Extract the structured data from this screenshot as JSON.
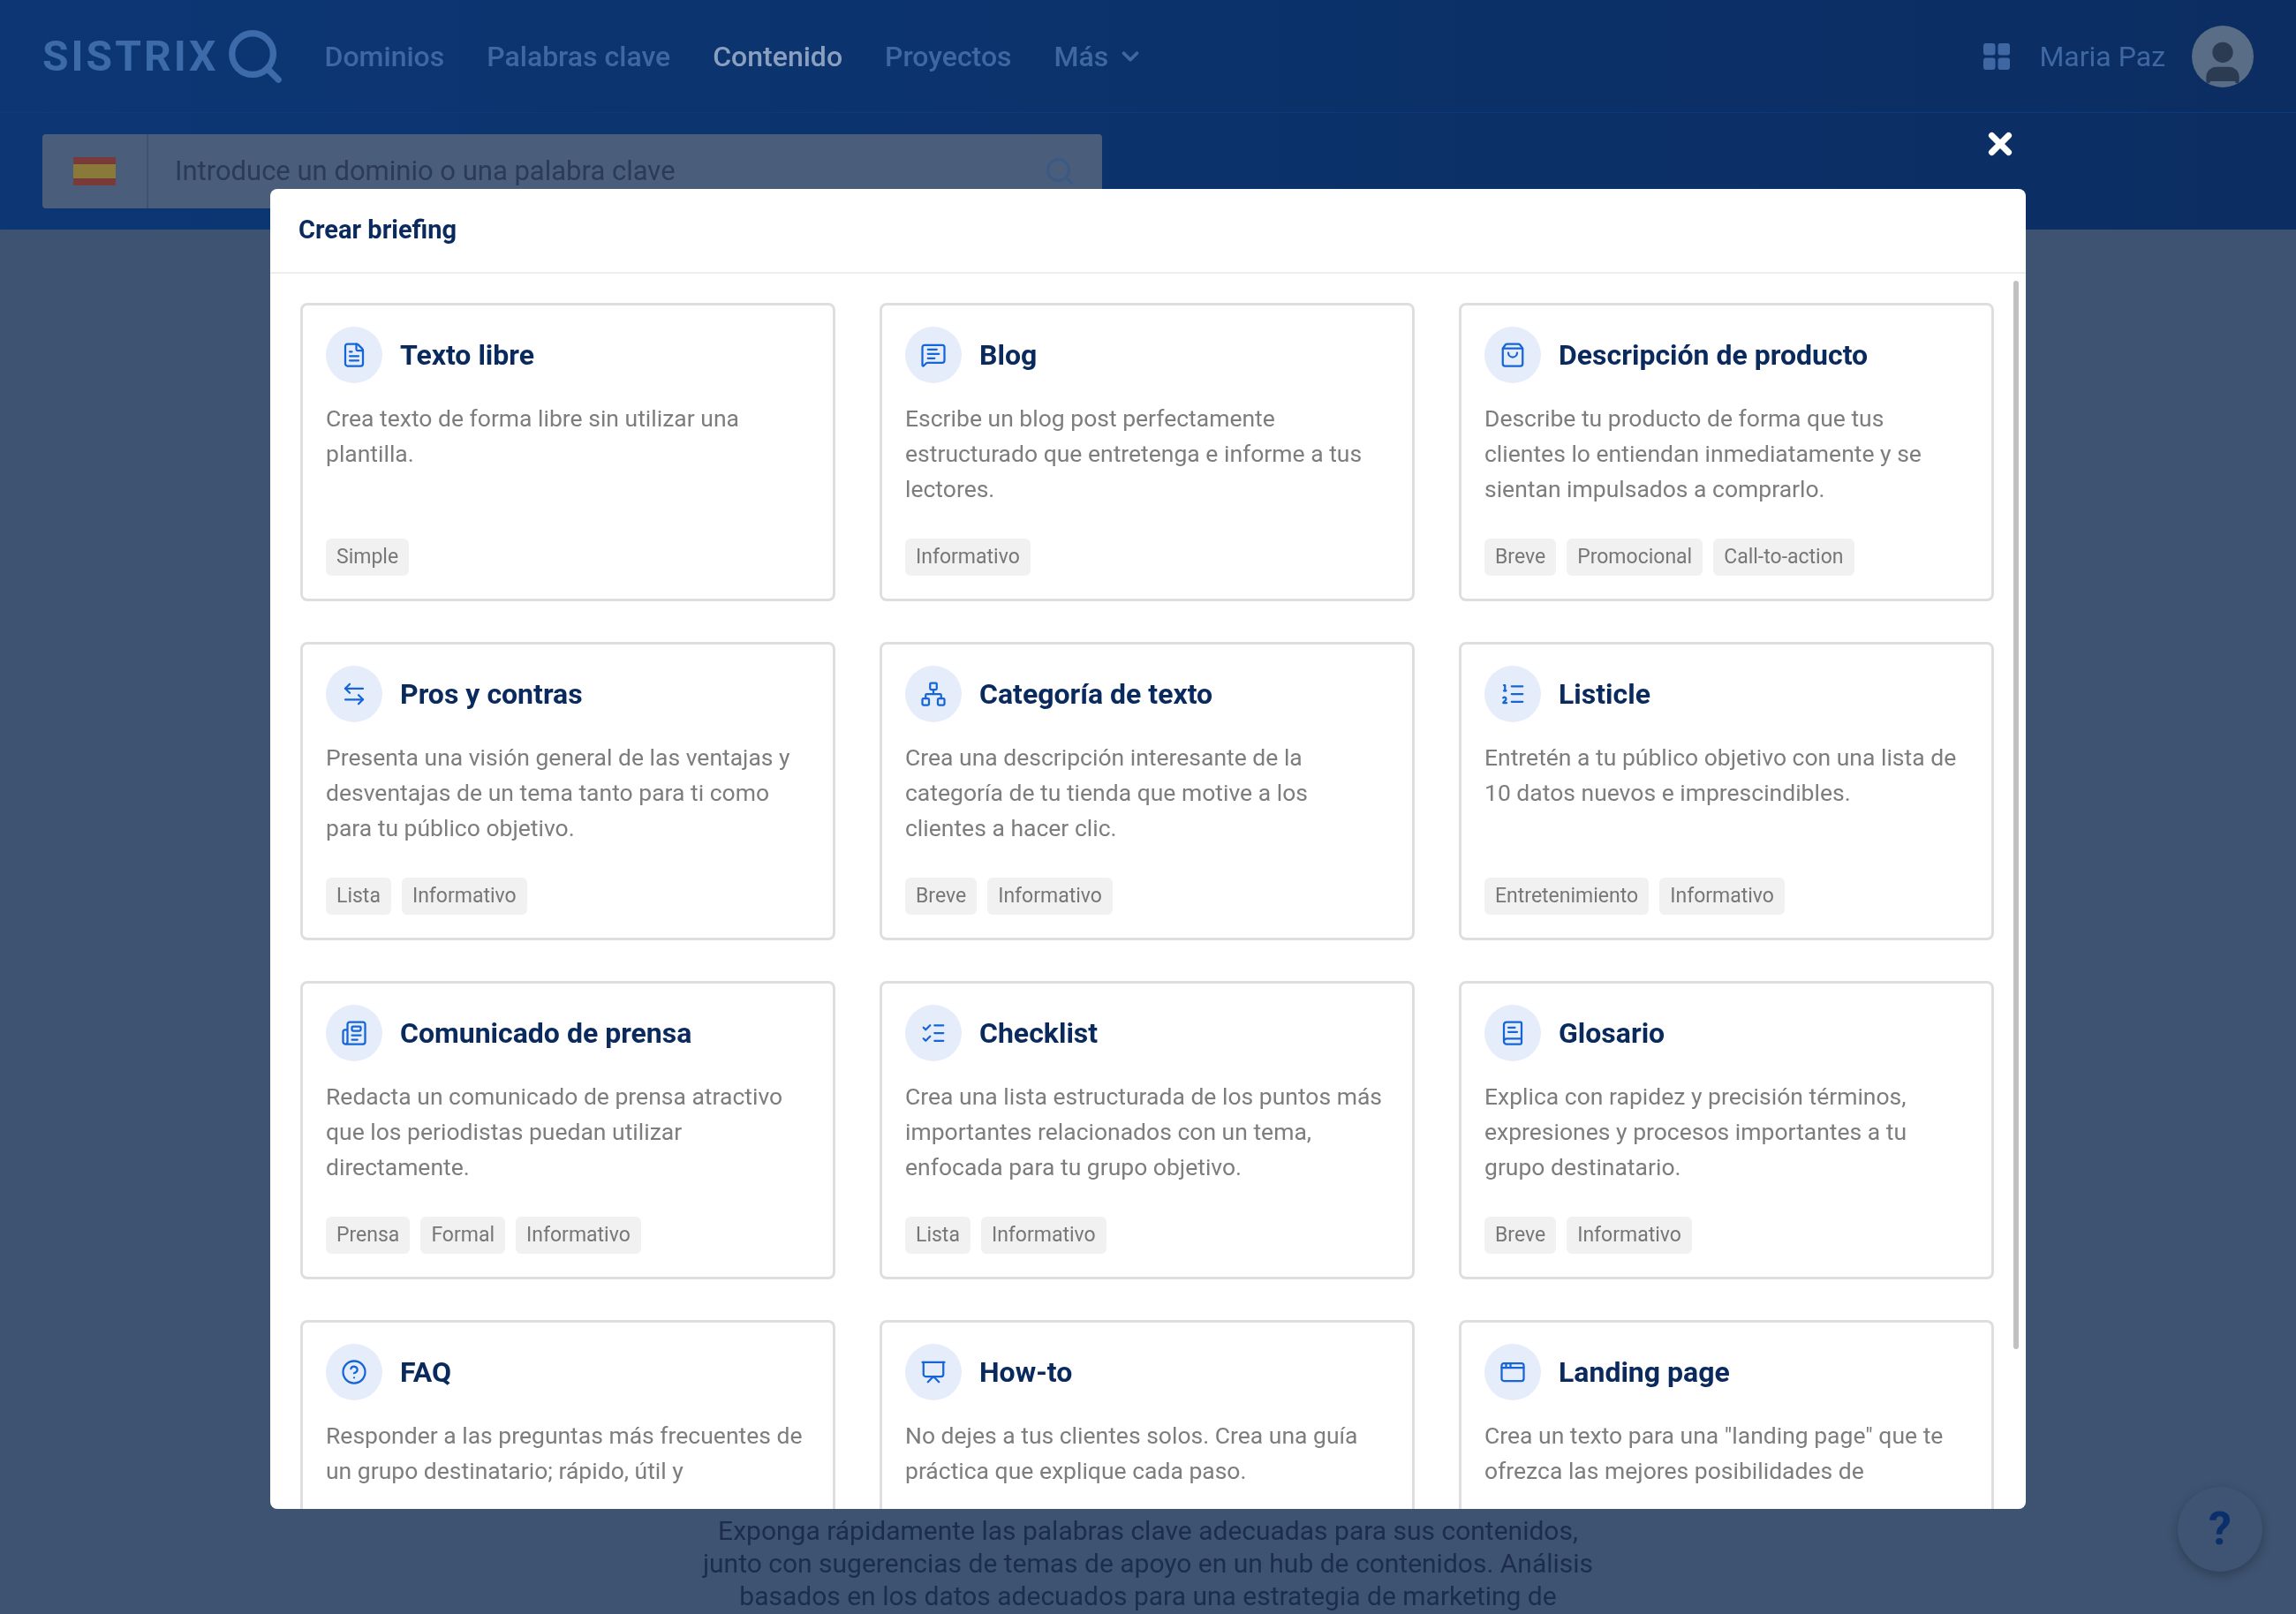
{
  "header": {
    "logo": "SISTRIX",
    "nav": [
      {
        "label": "Dominios",
        "selected": false
      },
      {
        "label": "Palabras clave",
        "selected": false
      },
      {
        "label": "Contenido",
        "selected": true
      },
      {
        "label": "Proyectos",
        "selected": false
      },
      {
        "label": "Más",
        "selected": false
      }
    ],
    "user_name": "Maria Paz"
  },
  "search": {
    "placeholder": "Introduce un dominio o una palabra clave"
  },
  "background_text": [
    "Exponga rápidamente las palabras clave adecuadas para sus contenidos,",
    "junto con sugerencias de temas de apoyo en un hub de contenidos. Análisis",
    "basados en los datos adecuados para una estrategia de marketing de"
  ],
  "help_button": "?",
  "modal": {
    "title": "Crear briefing",
    "cards": [
      {
        "title": "Texto libre",
        "description": "Crea texto de forma libre sin utilizar una plantilla.",
        "tags": [
          "Simple"
        ]
      },
      {
        "title": "Blog",
        "description": "Escribe un blog post perfectamente estructurado que entretenga e informe a tus lectores.",
        "tags": [
          "Informativo"
        ]
      },
      {
        "title": "Descripción de producto",
        "description": "Describe tu producto de forma que tus clientes lo entiendan inmediatamente y se sientan impulsados a comprarlo.",
        "tags": [
          "Breve",
          "Promocional",
          "Call-to-action"
        ]
      },
      {
        "title": "Pros y contras",
        "description": "Presenta una visión general de las ventajas y desventajas de un tema tanto para ti como para tu público objetivo.",
        "tags": [
          "Lista",
          "Informativo"
        ]
      },
      {
        "title": "Categoría de texto",
        "description": "Crea una descripción interesante de la categoría de tu tienda que motive a los clientes a hacer clic.",
        "tags": [
          "Breve",
          "Informativo"
        ]
      },
      {
        "title": "Listicle",
        "description": "Entretén a tu público objetivo con una lista de 10 datos nuevos e imprescindibles.",
        "tags": [
          "Entretenimiento",
          "Informativo"
        ]
      },
      {
        "title": "Comunicado de prensa",
        "description": "Redacta un comunicado de prensa atractivo que los periodistas puedan utilizar directamente.",
        "tags": [
          "Prensa",
          "Formal",
          "Informativo"
        ]
      },
      {
        "title": "Checklist",
        "description": "Crea una lista estructurada de los puntos más importantes relacionados con un tema, enfocada para tu grupo objetivo.",
        "tags": [
          "Lista",
          "Informativo"
        ]
      },
      {
        "title": "Glosario",
        "description": "Explica con rapidez y precisión términos, expresiones y procesos importantes a tu grupo destinatario.",
        "tags": [
          "Breve",
          "Informativo"
        ]
      },
      {
        "title": "FAQ",
        "description": "Responder a las preguntas más frecuentes de un grupo destinatario; rápido, útil y"
      },
      {
        "title": "How-to",
        "description": "No dejes a tus clientes solos. Crea una guía práctica que explique cada paso."
      },
      {
        "title": "Landing page",
        "description": "Crea un texto para una \"landing page\" que te ofrezca las mejores posibilidades de"
      }
    ]
  }
}
